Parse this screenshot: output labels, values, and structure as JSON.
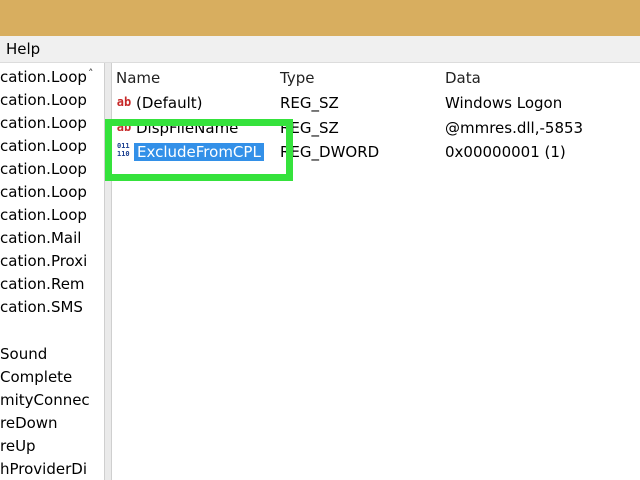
{
  "menubar": {
    "help_label": "Help"
  },
  "tree": {
    "items": [
      "cation.Loop",
      "cation.Loop",
      "cation.Loop",
      "cation.Loop",
      "cation.Loop",
      "cation.Loop",
      "cation.Loop",
      "cation.Mail",
      "cation.Proxi",
      "cation.Rem",
      "cation.SMS",
      "Sound",
      "Complete",
      "mityConnec",
      "reDown",
      "reUp",
      "hProviderDi"
    ]
  },
  "columns": {
    "name": "Name",
    "type": "Type",
    "data": "Data"
  },
  "rows": [
    {
      "name": "(Default)",
      "type": "REG_SZ",
      "data": "Windows Logon"
    },
    {
      "name": "DispFileName",
      "type": "REG_SZ",
      "data": "@mmres.dll,-5853"
    },
    {
      "name": "ExcludeFromCPL",
      "type": "REG_DWORD",
      "data": "0x00000001 (1)"
    }
  ],
  "icons": {
    "string_value": "string-value-icon",
    "binary_value": "binary-value-icon",
    "scroll_up": "scroll-up-icon"
  },
  "colors": {
    "titlebar": "#d8ae5f",
    "selection": "#3390e8",
    "highlight": "#35e23c"
  }
}
